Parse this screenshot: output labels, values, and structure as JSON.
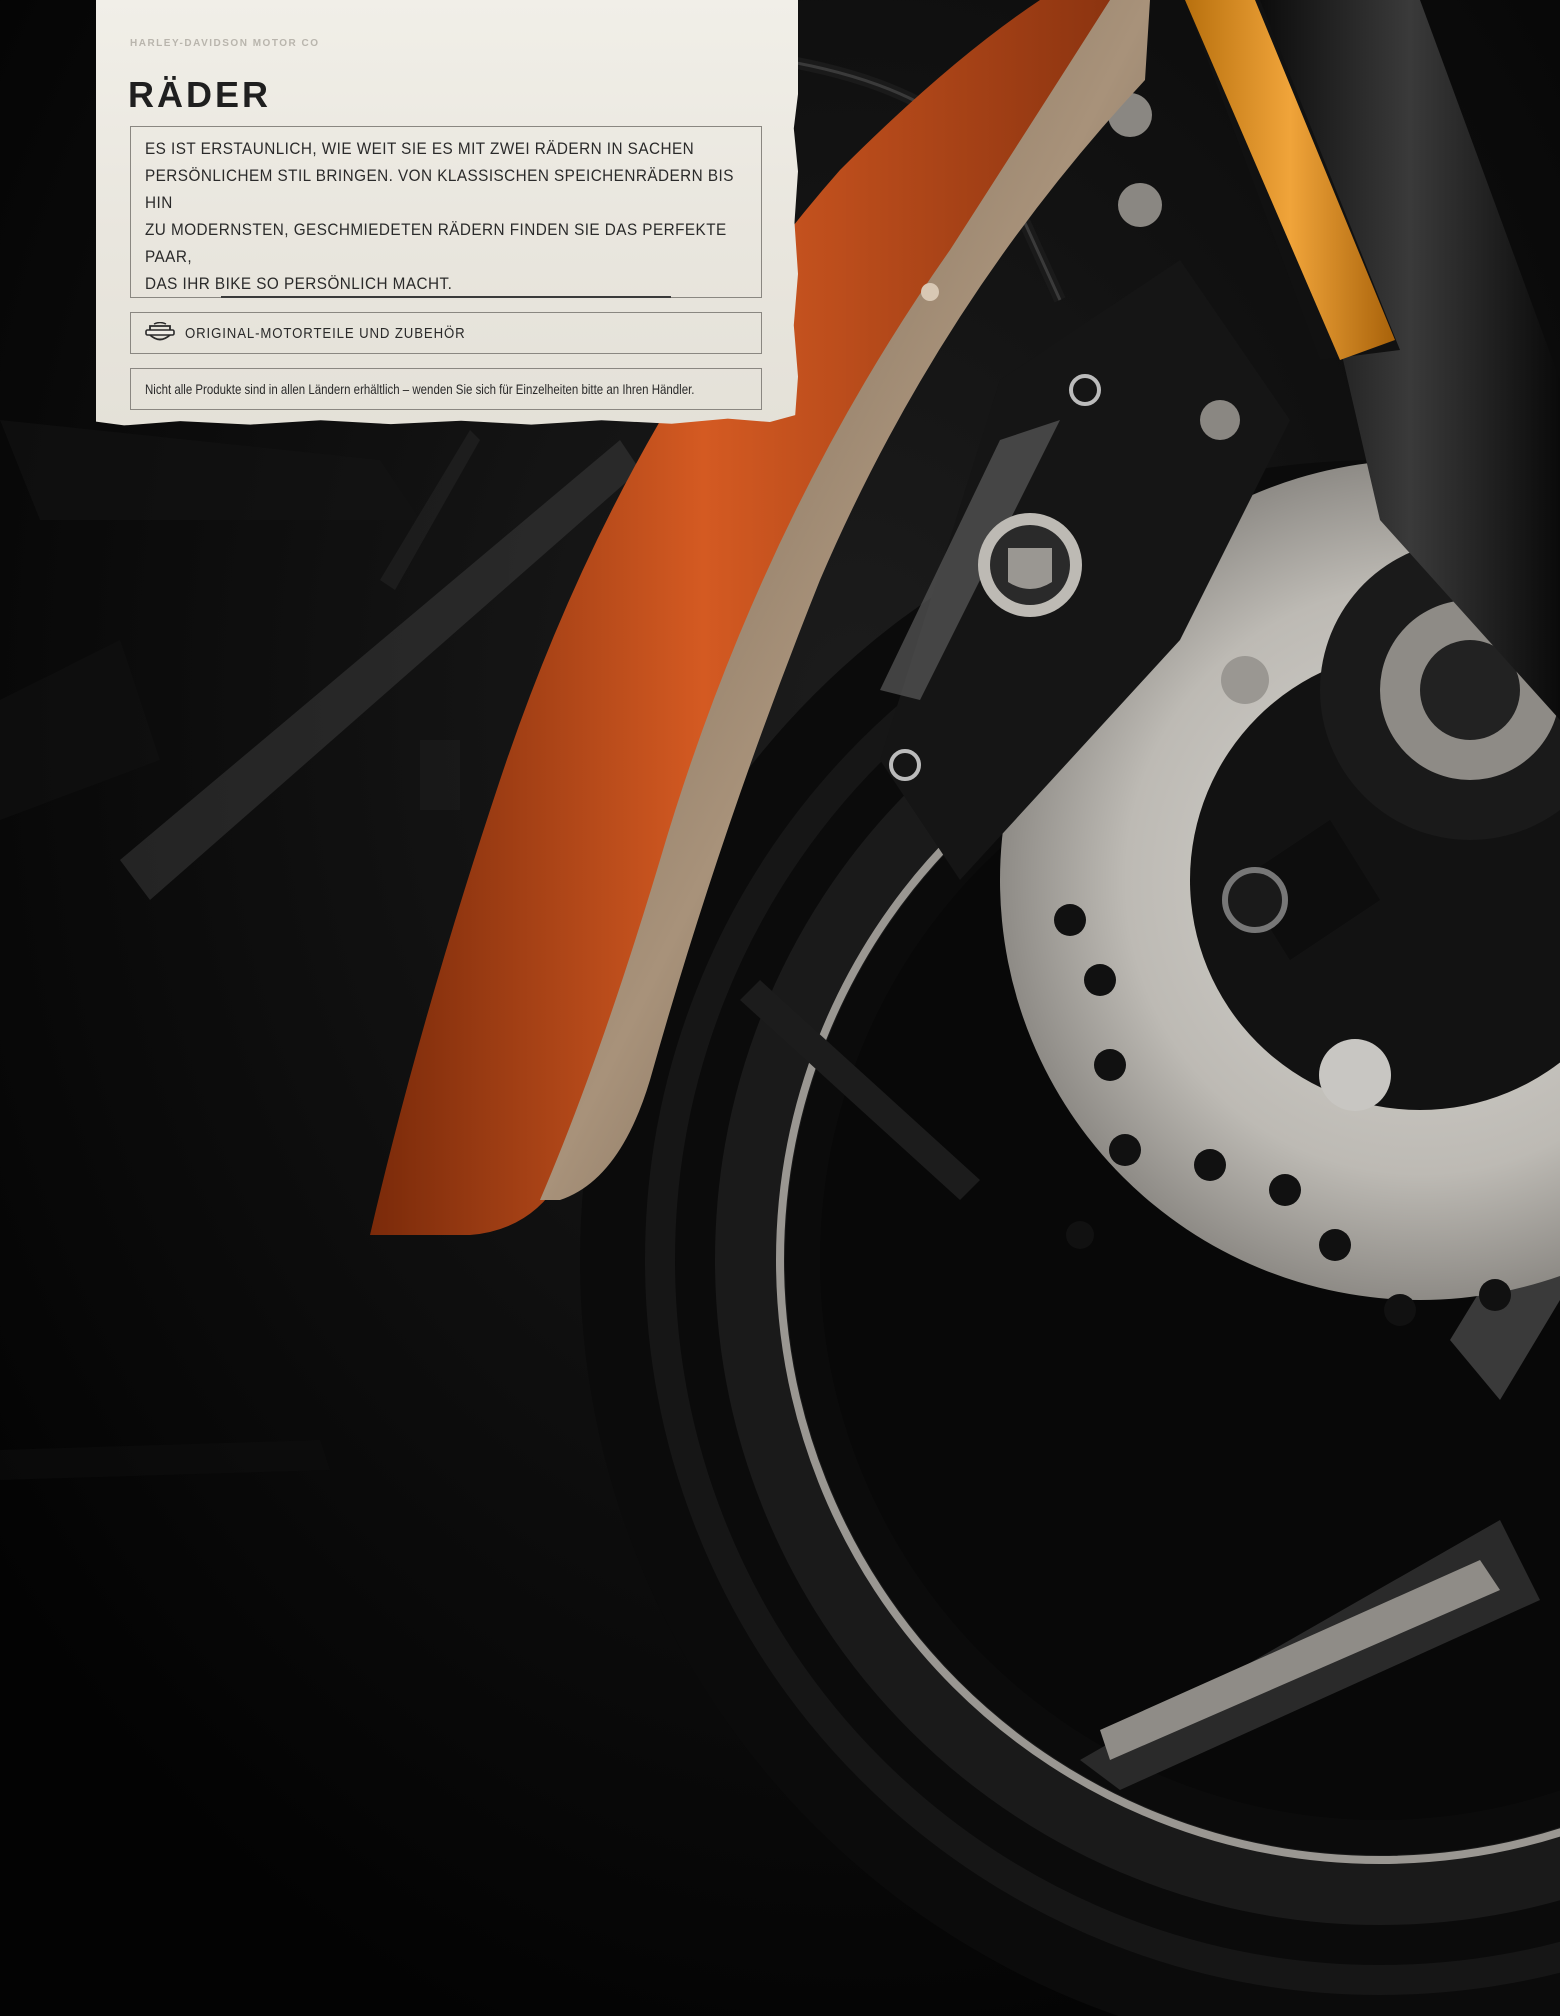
{
  "header": {
    "brand": "HARLEY-DAVIDSON MOTOR CO"
  },
  "section": {
    "title": "RÄDER",
    "intro_lines": [
      "ES IST ERSTAUNLICH, WIE WEIT SIE ES MIT ZWEI RÄDERN IN SACHEN",
      "PERSÖNLICHEM STIL BRINGEN. VON KLASSISCHEN SPEICHENRÄDERN BIS HIN",
      "ZU MODERNSTEN, GESCHMIEDETEN RÄDERN FINDEN SIE DAS PERFEKTE PAAR,",
      "DAS IHR BIKE SO PERSÖNLICH MACHT."
    ],
    "parts_label": "ORIGINAL-MOTORTEILE UND ZUBEHÖR",
    "icon": "bar-and-shield-icon",
    "availability_note": "Nicht alle Produkte sind in allen Ländern erhältlich – wenden Sie sich für Einzelheiten bitte an Ihren Händler."
  },
  "colors": {
    "paper": "#ece9e2",
    "fender_orange": "#c8521e",
    "fender_tan": "#a08a70",
    "reflector": "#e89a1c",
    "background": "#050505"
  }
}
